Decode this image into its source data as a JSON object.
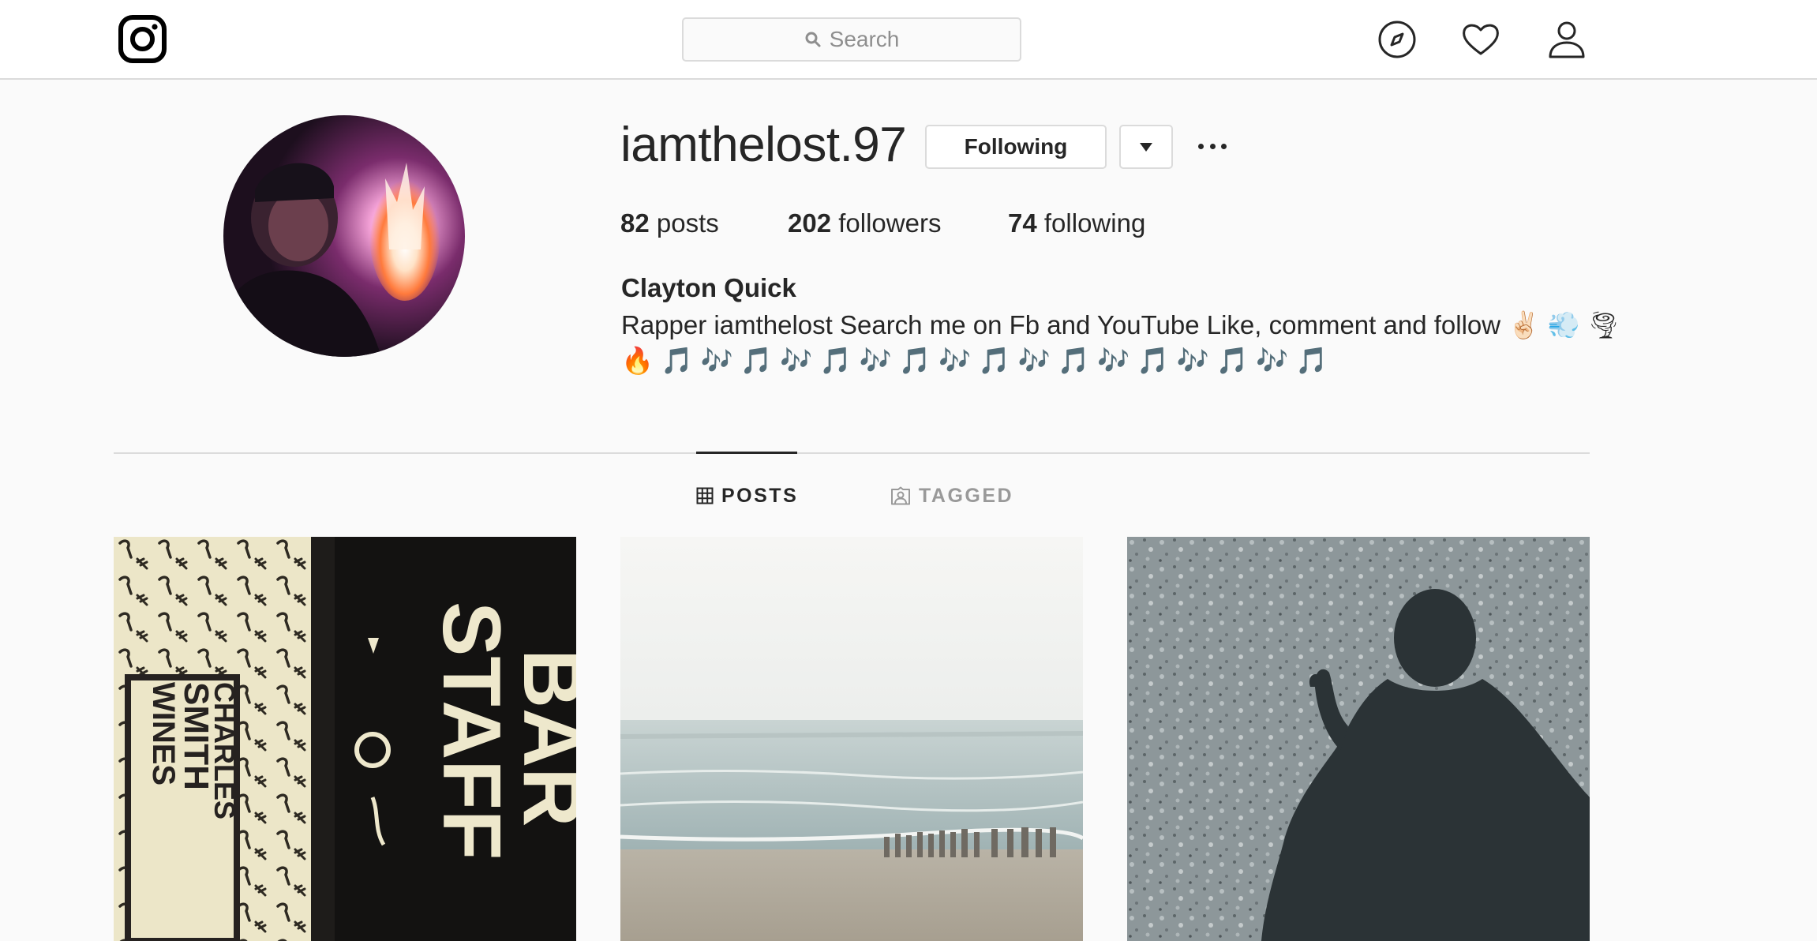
{
  "nav": {
    "search_placeholder": "Search",
    "icons": [
      "instagram-logo-icon",
      "search-icon",
      "compass-icon",
      "heart-icon",
      "user-icon"
    ]
  },
  "profile": {
    "username": "iamthelost.97",
    "following_button": "Following",
    "stats": {
      "posts_count": "82",
      "posts_label": "posts",
      "followers_count": "202",
      "followers_label": "followers",
      "following_count": "74",
      "following_label": "following"
    },
    "full_name": "Clayton Quick",
    "bio_line1": "Rapper iamthelost Search me on Fb and YouTube Like, comment and follow ✌🏻 💨 🌪",
    "bio_line2": "🔥 🎵 🎶 🎵 🎶 🎵 🎶 🎵 🎶 🎵 🎶 🎵 🎶 🎵 🎶 🎵 🎶 🎵"
  },
  "tabs": [
    {
      "label": "POSTS",
      "active": true
    },
    {
      "label": "TAGGED",
      "active": false
    }
  ],
  "posts": {
    "post1_text": {
      "charles": "CHARLES",
      "smith": "SMITH",
      "wines": "WINES",
      "bar": "BAR",
      "staff": "STAFF"
    }
  },
  "colors": {
    "background": "#fafafa",
    "border": "#dbdbdb",
    "text": "#262626",
    "muted": "#8e8e8e"
  }
}
